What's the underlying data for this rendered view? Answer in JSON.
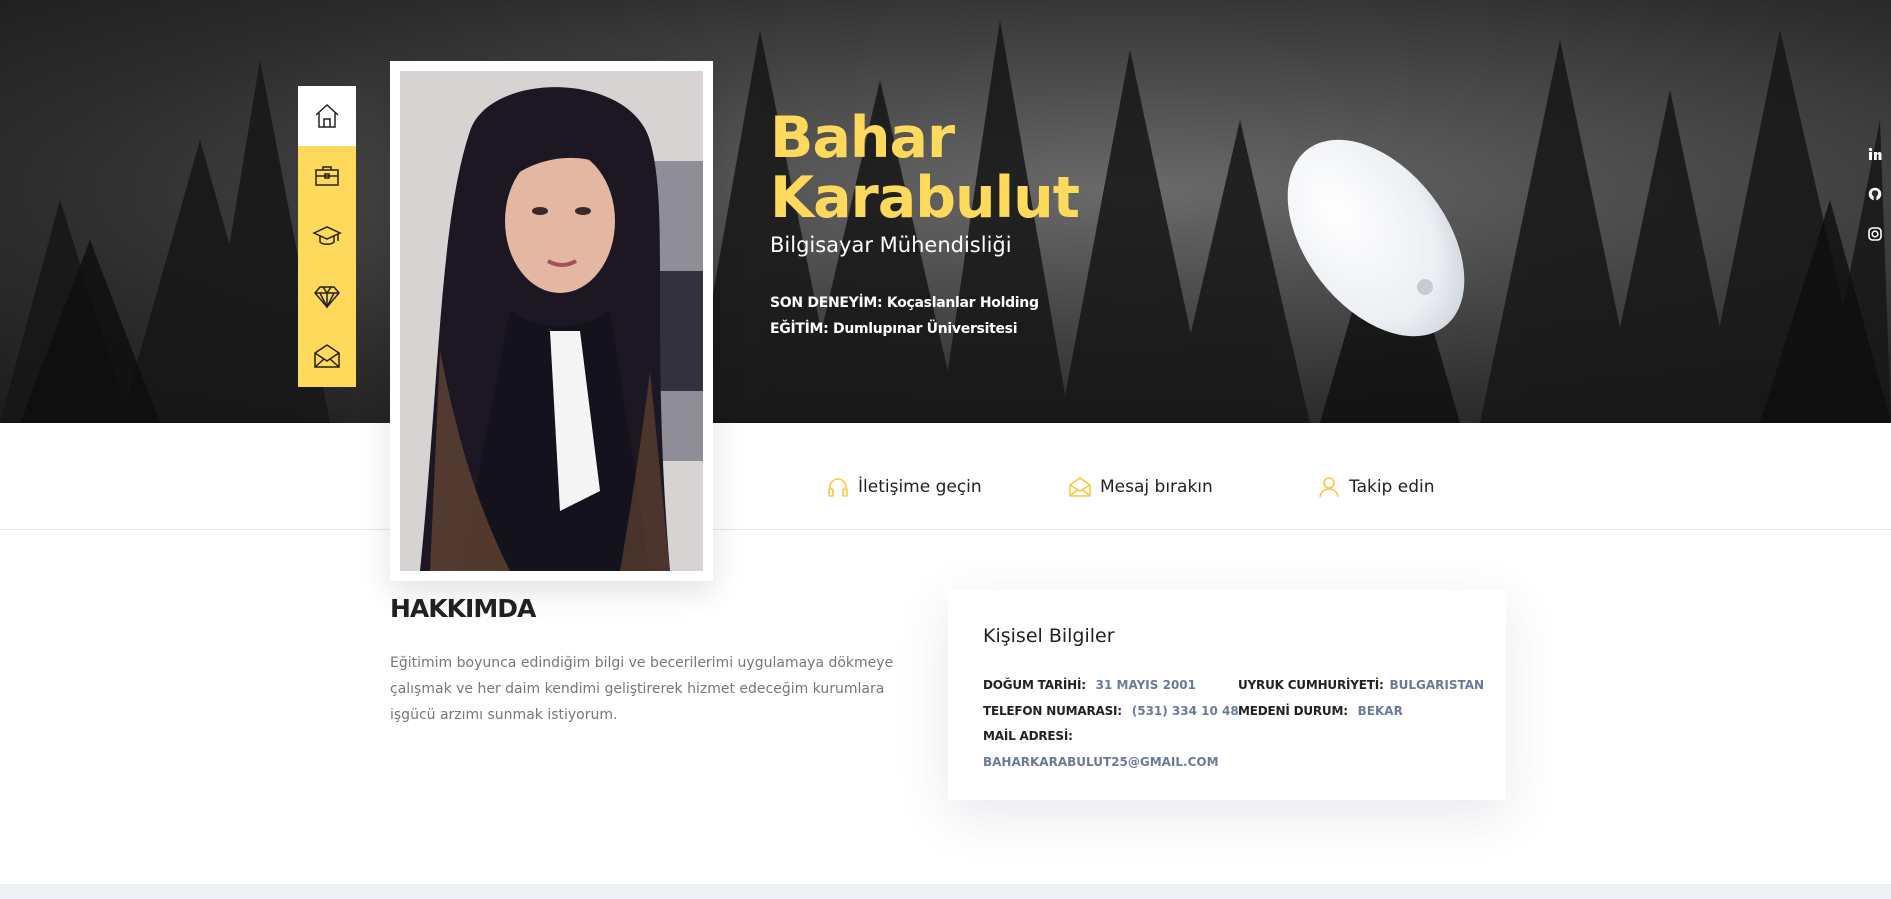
{
  "profile": {
    "first_name": "Bahar",
    "last_name": "Karabulut",
    "profession": "Bilgisayar Mühendisliği",
    "experience_label": "SON DENEYİM:",
    "experience_value": "Koçaslanlar Holding",
    "education_label": "EĞİTİM:",
    "education_value": "Dumlupınar Üniversitesi"
  },
  "nav": {
    "items": [
      {
        "icon": "home-icon"
      },
      {
        "icon": "briefcase-icon"
      },
      {
        "icon": "graduation-cap-icon"
      },
      {
        "icon": "diamond-icon"
      },
      {
        "icon": "envelope-icon"
      }
    ]
  },
  "social": {
    "items": [
      {
        "icon": "linkedin-icon"
      },
      {
        "icon": "github-icon"
      },
      {
        "icon": "instagram-icon"
      }
    ]
  },
  "contact": {
    "get_in_touch": "İletişime geçin",
    "leave_message": "Mesaj bırakın",
    "follow": "Takip edin"
  },
  "about": {
    "title": "HAKKIMDA",
    "text": "Eğitimim boyunca edindiğim bilgi ve becerilerimi uygulamaya dökmeye çalışmak ve her daim kendimi geliştirerek hizmet edeceğim kurumlara işgücü arzımı sunmak istiyorum."
  },
  "personal": {
    "title": "Kişisel Bilgiler",
    "birth_label": "DOĞUM TARİHİ:",
    "birth_value": "31 MAYIS 2001",
    "phone_label": "TELEFON NUMARASI:",
    "phone_value": "(531) 334 10 48",
    "email_label": "MAİL ADRESİ:",
    "email_value": "BAHARKARABULUT25@GMAIL.COM",
    "nationality_label": "UYRUK CUMHURİYETİ:",
    "nationality_value": "BULGARISTAN",
    "marital_label": "MEDENİ DURUM:",
    "marital_value": "BEKAR"
  },
  "colors": {
    "accent": "#ffd95b",
    "value_text": "#6b7a9a"
  }
}
